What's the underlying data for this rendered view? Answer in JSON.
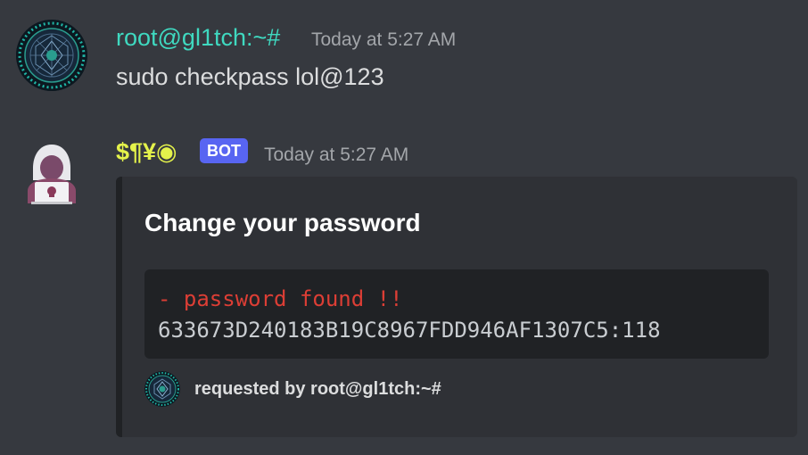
{
  "messages": [
    {
      "author": "root@gl1tch:~#",
      "author_color": "#3fd9c0",
      "timestamp": "Today at 5:27 AM",
      "content": "sudo checkpass lol@123",
      "avatar_icon": "mandala-avatar-icon"
    },
    {
      "author": "$¶¥◉",
      "author_color": "#e4f24b",
      "badge": "BOT",
      "timestamp": "Today at 5:27 AM",
      "avatar_icon": "hooded-hacker-avatar-icon",
      "embed": {
        "title": "Change your password",
        "code_line_1": "- password found !!",
        "code_line_2": "633673D240183B19C8967FDD946AF1307C5:118",
        "footer_text": "requested by root@gl1tch:~#",
        "footer_icon": "mandala-avatar-icon"
      }
    }
  ],
  "colors": {
    "background": "#36393f",
    "embed_background": "#2f3136",
    "code_background": "#202225",
    "code_red": "#dc3e35",
    "badge": "#5865f2"
  }
}
